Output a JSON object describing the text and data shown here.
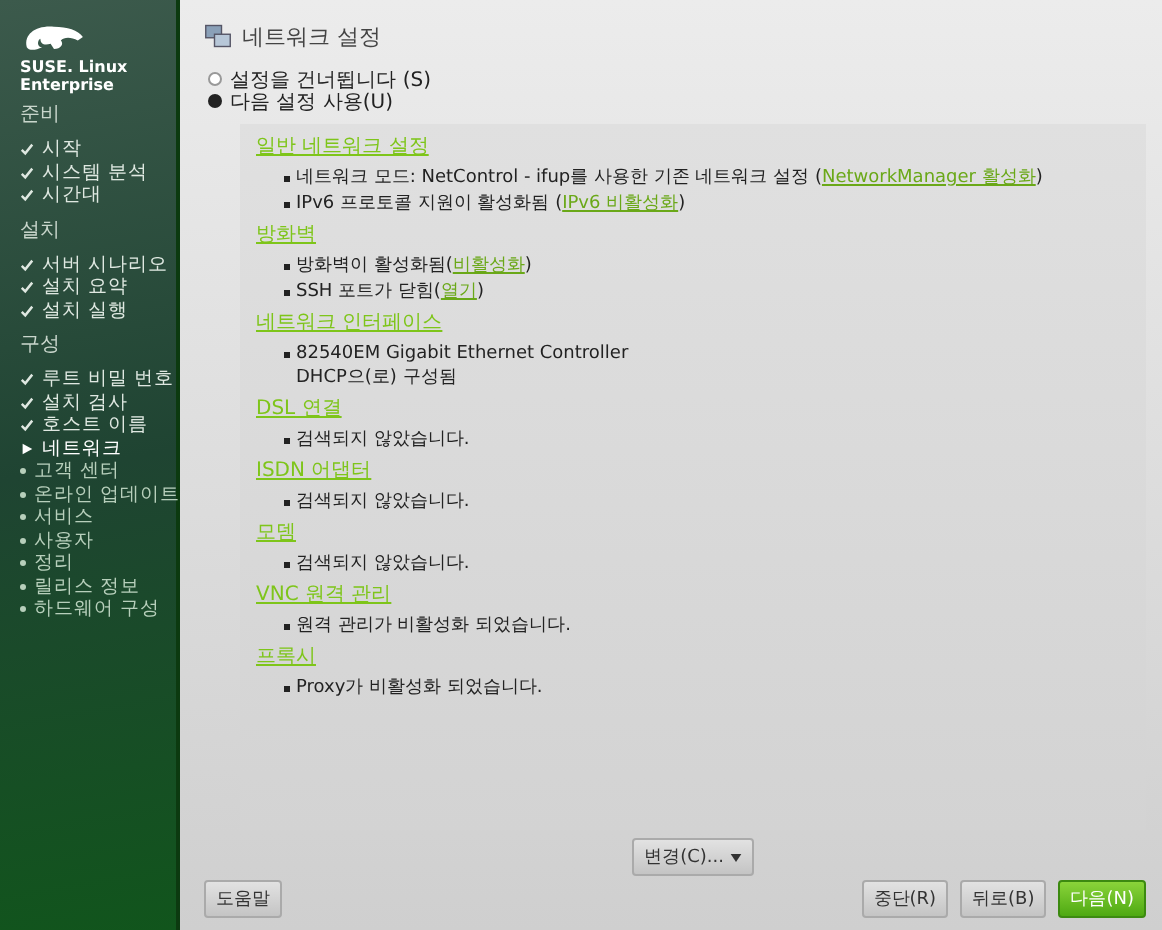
{
  "brand": {
    "line_1": "SUSE. Linux",
    "line_2": "Enterprise"
  },
  "sidebar": {
    "groups": [
      {
        "title": "준비",
        "items": [
          {
            "label": "시작",
            "done": true,
            "current": false
          },
          {
            "label": "시스템 분석",
            "done": true,
            "current": false
          },
          {
            "label": "시간대",
            "done": true,
            "current": false
          }
        ]
      },
      {
        "title": "설치",
        "items": [
          {
            "label": "서버 시나리오",
            "done": true,
            "current": false
          },
          {
            "label": "설치 요약",
            "done": true,
            "current": false
          },
          {
            "label": "설치 실행",
            "done": true,
            "current": false
          }
        ]
      },
      {
        "title": "구성",
        "items": [
          {
            "label": "루트 비밀 번호",
            "done": true,
            "current": false
          },
          {
            "label": "설치 검사",
            "done": true,
            "current": false
          },
          {
            "label": "호스트 이름",
            "done": true,
            "current": false
          },
          {
            "label": "네트워크",
            "done": false,
            "current": true
          },
          {
            "label": "고객 센터",
            "done": false,
            "current": false
          },
          {
            "label": "온라인 업데이트",
            "done": false,
            "current": false
          },
          {
            "label": "서비스",
            "done": false,
            "current": false
          },
          {
            "label": "사용자",
            "done": false,
            "current": false
          },
          {
            "label": "정리",
            "done": false,
            "current": false
          },
          {
            "label": "릴리스 정보",
            "done": false,
            "current": false
          },
          {
            "label": "하드웨어 구성",
            "done": false,
            "current": false
          }
        ]
      }
    ]
  },
  "title": "네트워크 설정",
  "options": [
    {
      "label": "설정을 건너뜁니다 (S)",
      "selected": false
    },
    {
      "label": "다음 설정 사용(U)",
      "selected": true
    }
  ],
  "sections": [
    {
      "heading": "일반 네트워크 설정",
      "bullets": [
        {
          "text": "네트워크 모드: NetControl - ifup를 사용한 기존 네트워크 설정 (",
          "link": "NetworkManager 활성화",
          "tail": ")"
        },
        {
          "text": "IPv6 프로토콜 지원이 활성화됨 (",
          "link": "IPv6 비활성화",
          "tail": ")"
        }
      ]
    },
    {
      "heading": "방화벽",
      "bullets": [
        {
          "text": "방화벽이 활성화됨(",
          "link": "비활성화",
          "tail": ")"
        },
        {
          "text": "SSH 포트가 닫힘(",
          "link": "열기",
          "tail": ")"
        }
      ]
    },
    {
      "heading": "네트워크 인터페이스",
      "bullets": [
        {
          "text": "82540EM Gigabit Ethernet Controller",
          "line_2": "DHCP으(로) 구성됨"
        }
      ]
    },
    {
      "heading": "DSL 연결",
      "bullets": [
        {
          "text": "검색되지 않았습니다."
        }
      ]
    },
    {
      "heading": "ISDN 어댑터",
      "bullets": [
        {
          "text": "검색되지 않았습니다."
        }
      ]
    },
    {
      "heading": "모뎀",
      "bullets": [
        {
          "text": "검색되지 않았습니다."
        }
      ]
    },
    {
      "heading": "VNC 원격 관리",
      "bullets": [
        {
          "text": "원격 관리가 비활성화 되었습니다."
        }
      ]
    },
    {
      "heading": "프록시",
      "bullets": [
        {
          "text": "Proxy가 비활성화 되었습니다."
        }
      ]
    }
  ],
  "change_button": "변경(C)...",
  "buttons": {
    "help": "도움말",
    "abort": "중단(R)",
    "back": "뒤로(B)",
    "next": "다음(N)"
  }
}
